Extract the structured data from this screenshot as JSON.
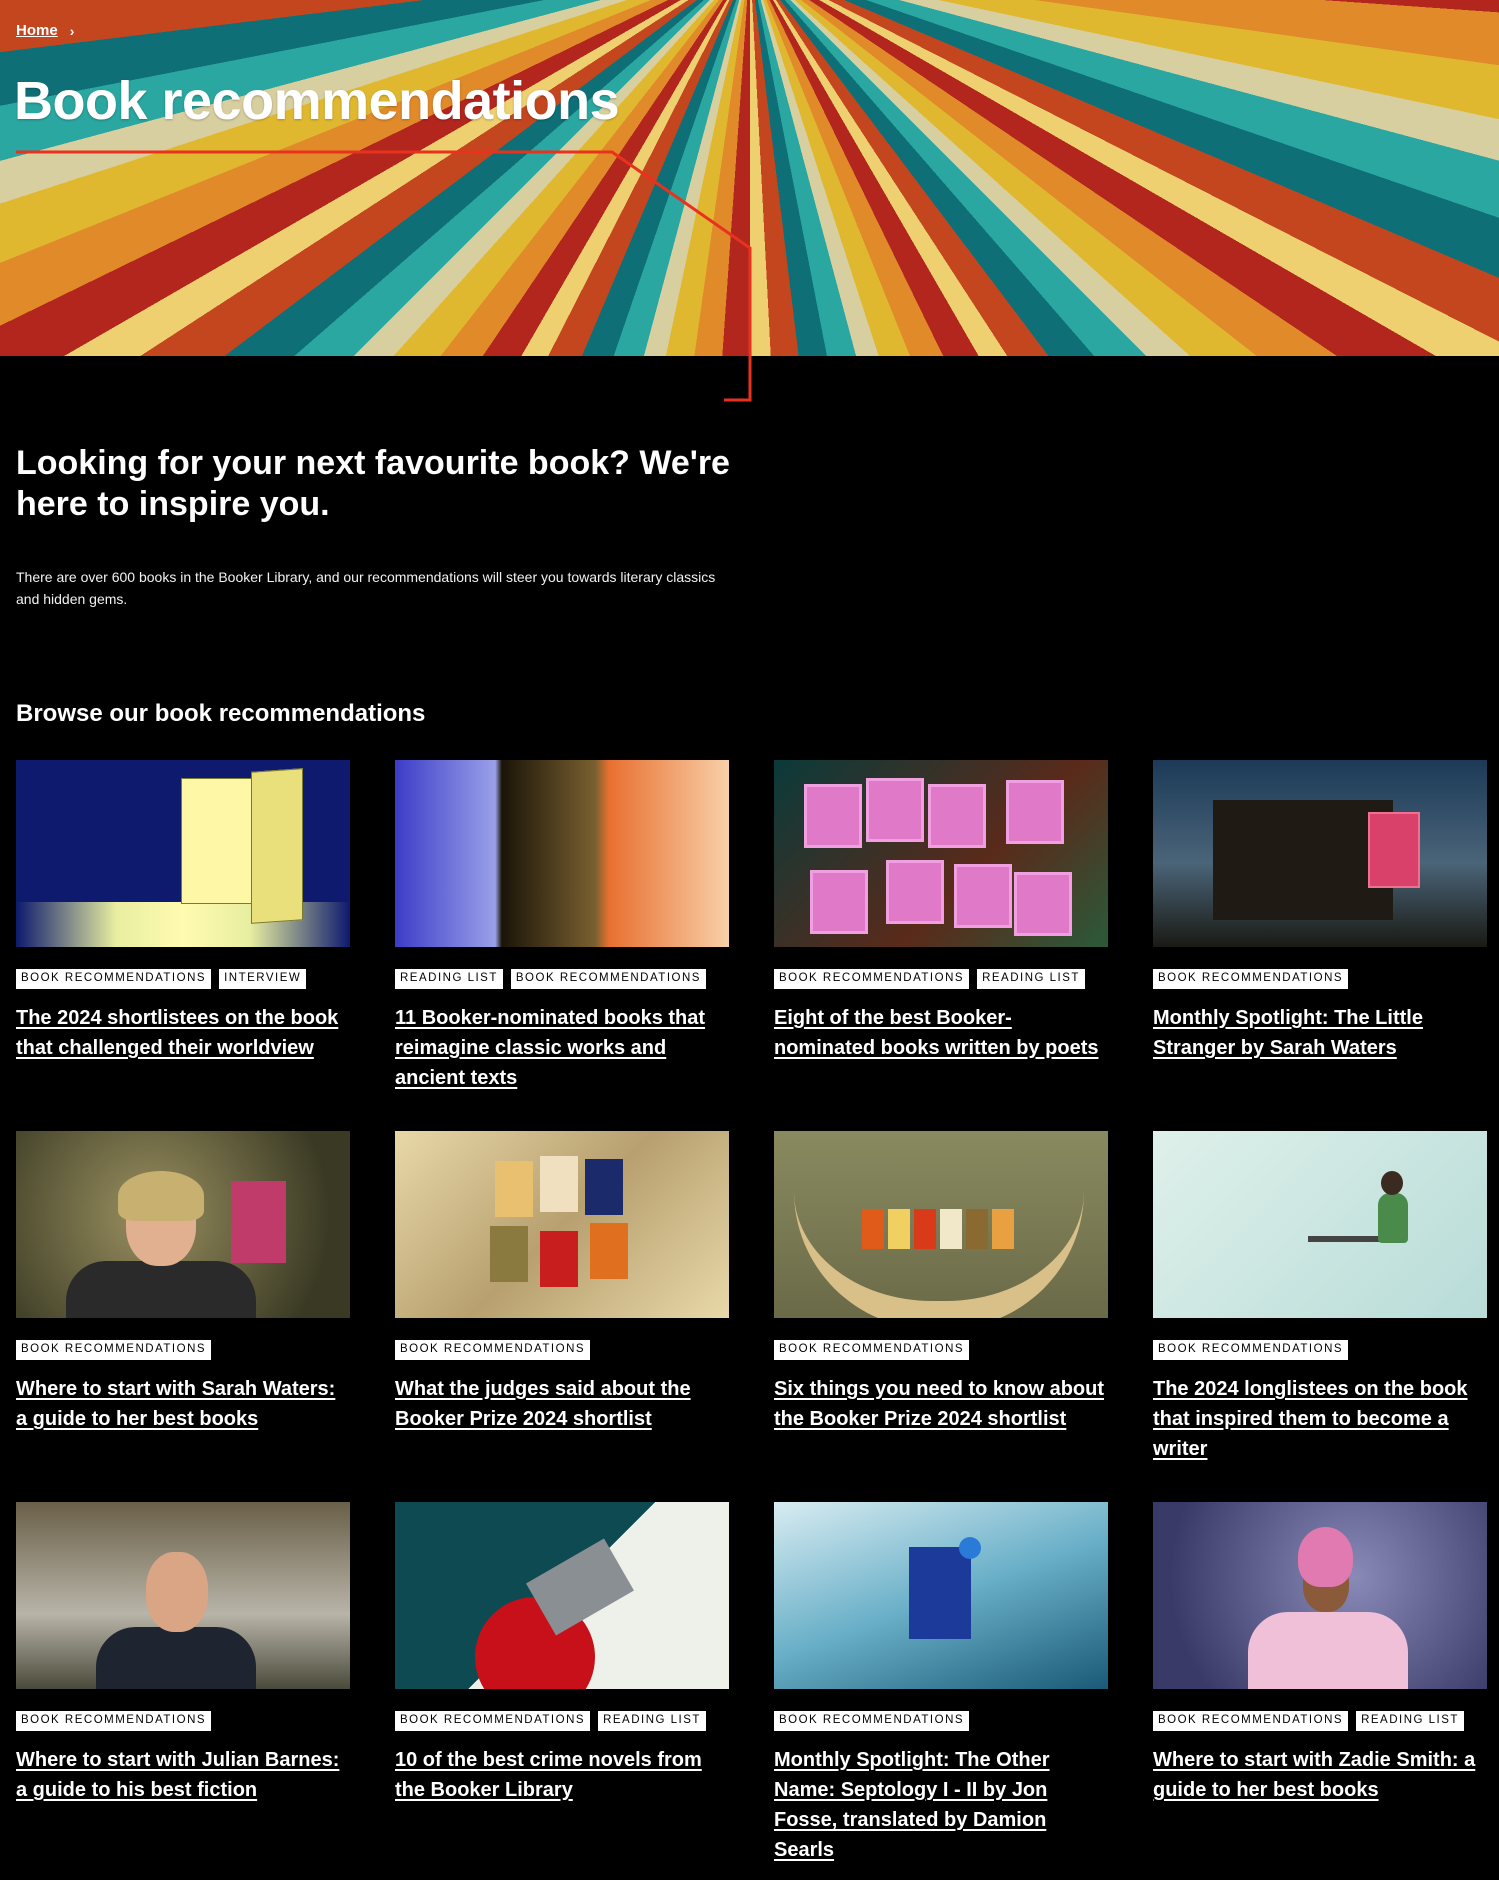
{
  "breadcrumb": {
    "home": "Home",
    "separator": "›"
  },
  "page_title": "Book recommendations",
  "intro": {
    "heading": "Looking for your next favourite book? We're here to inspire you.",
    "text": "There are over 600 books in the Booker Library, and our recommendations will steer you towards literary classics and hidden gems."
  },
  "browse_heading": "Browse our book recommendations",
  "colors": {
    "accent_line": "#e8321e",
    "background": "#000000",
    "tag_bg": "#ffffff"
  },
  "cards": [
    {
      "tags": [
        "BOOK RECOMMENDATIONS",
        "INTERVIEW"
      ],
      "title": "The 2024 shortlistees on the book that challenged their worldview"
    },
    {
      "tags": [
        "READING LIST",
        "BOOK RECOMMENDATIONS"
      ],
      "title": "11 Booker-nominated books that reimagine classic works and ancient texts"
    },
    {
      "tags": [
        "BOOK RECOMMENDATIONS",
        "READING LIST"
      ],
      "title": "Eight of the best Booker-nominated books written by poets"
    },
    {
      "tags": [
        "BOOK RECOMMENDATIONS"
      ],
      "title": "Monthly Spotlight: The Little Stranger by Sarah Waters"
    },
    {
      "tags": [
        "BOOK RECOMMENDATIONS"
      ],
      "title": "Where to start with Sarah Waters: a guide to her best books"
    },
    {
      "tags": [
        "BOOK RECOMMENDATIONS"
      ],
      "title": "What the judges said about the Booker Prize 2024 shortlist"
    },
    {
      "tags": [
        "BOOK RECOMMENDATIONS"
      ],
      "title": "Six things you need to know about the Booker Prize 2024 shortlist"
    },
    {
      "tags": [
        "BOOK RECOMMENDATIONS"
      ],
      "title": "The 2024 longlistees on the book that inspired them to become a writer"
    },
    {
      "tags": [
        "BOOK RECOMMENDATIONS"
      ],
      "title": "Where to start with Julian Barnes: a guide to his best fiction"
    },
    {
      "tags": [
        "BOOK RECOMMENDATIONS",
        "READING LIST"
      ],
      "title": "10 of the best crime novels from the Booker Library"
    },
    {
      "tags": [
        "BOOK RECOMMENDATIONS"
      ],
      "title": "Monthly Spotlight: The Other Name: Septology I - II by Jon Fosse, translated by Damion Searls"
    },
    {
      "tags": [
        "BOOK RECOMMENDATIONS",
        "READING LIST"
      ],
      "title": "Where to start with Zadie Smith: a guide to her best books"
    }
  ]
}
